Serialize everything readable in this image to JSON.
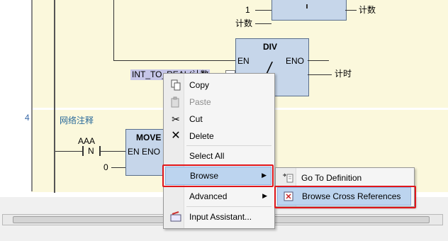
{
  "ladder": {
    "network3": {
      "const_one": "1",
      "counter_label_1": "计数",
      "counter_label_2": "计数",
      "div_block": {
        "title": "DIV",
        "en": "EN",
        "eno": "ENO",
        "op_symbol": "/"
      },
      "input_text": "INT_TO_REAL(计数",
      "output_label": "计时"
    },
    "network4": {
      "number": "4",
      "comment": "网络注释",
      "contact_name": "AAA",
      "contact_symbol": "N",
      "const_zero": "0",
      "move_block": {
        "title": "MOVE",
        "en": "EN",
        "eno": "ENO"
      }
    }
  },
  "context_menu": {
    "items": [
      {
        "label": "Copy",
        "icon": "copy-icon",
        "enabled": true
      },
      {
        "label": "Paste",
        "icon": "paste-icon",
        "enabled": false
      },
      {
        "label": "Cut",
        "icon": "cut-icon",
        "enabled": true
      },
      {
        "label": "Delete",
        "icon": "delete-icon",
        "enabled": true
      },
      {
        "label": "Select All",
        "icon": "",
        "enabled": true
      },
      {
        "label": "Browse",
        "icon": "",
        "enabled": true,
        "submenu": true,
        "highlighted": true
      },
      {
        "label": "Advanced",
        "icon": "",
        "enabled": true,
        "submenu": true
      },
      {
        "label": "Input Assistant...",
        "icon": "input-assistant-icon",
        "enabled": true
      }
    ]
  },
  "submenu": {
    "items": [
      {
        "label": "Go To Definition",
        "icon": "go-to-definition-icon"
      },
      {
        "label": "Browse Cross References",
        "icon": "cross-references-icon",
        "highlighted": true
      }
    ]
  },
  "colors": {
    "network_bg": "#fbf8dc",
    "block_fill": "#c6d6ea",
    "highlight": "#bcd4ef",
    "annotation_red": "#e0161b"
  }
}
